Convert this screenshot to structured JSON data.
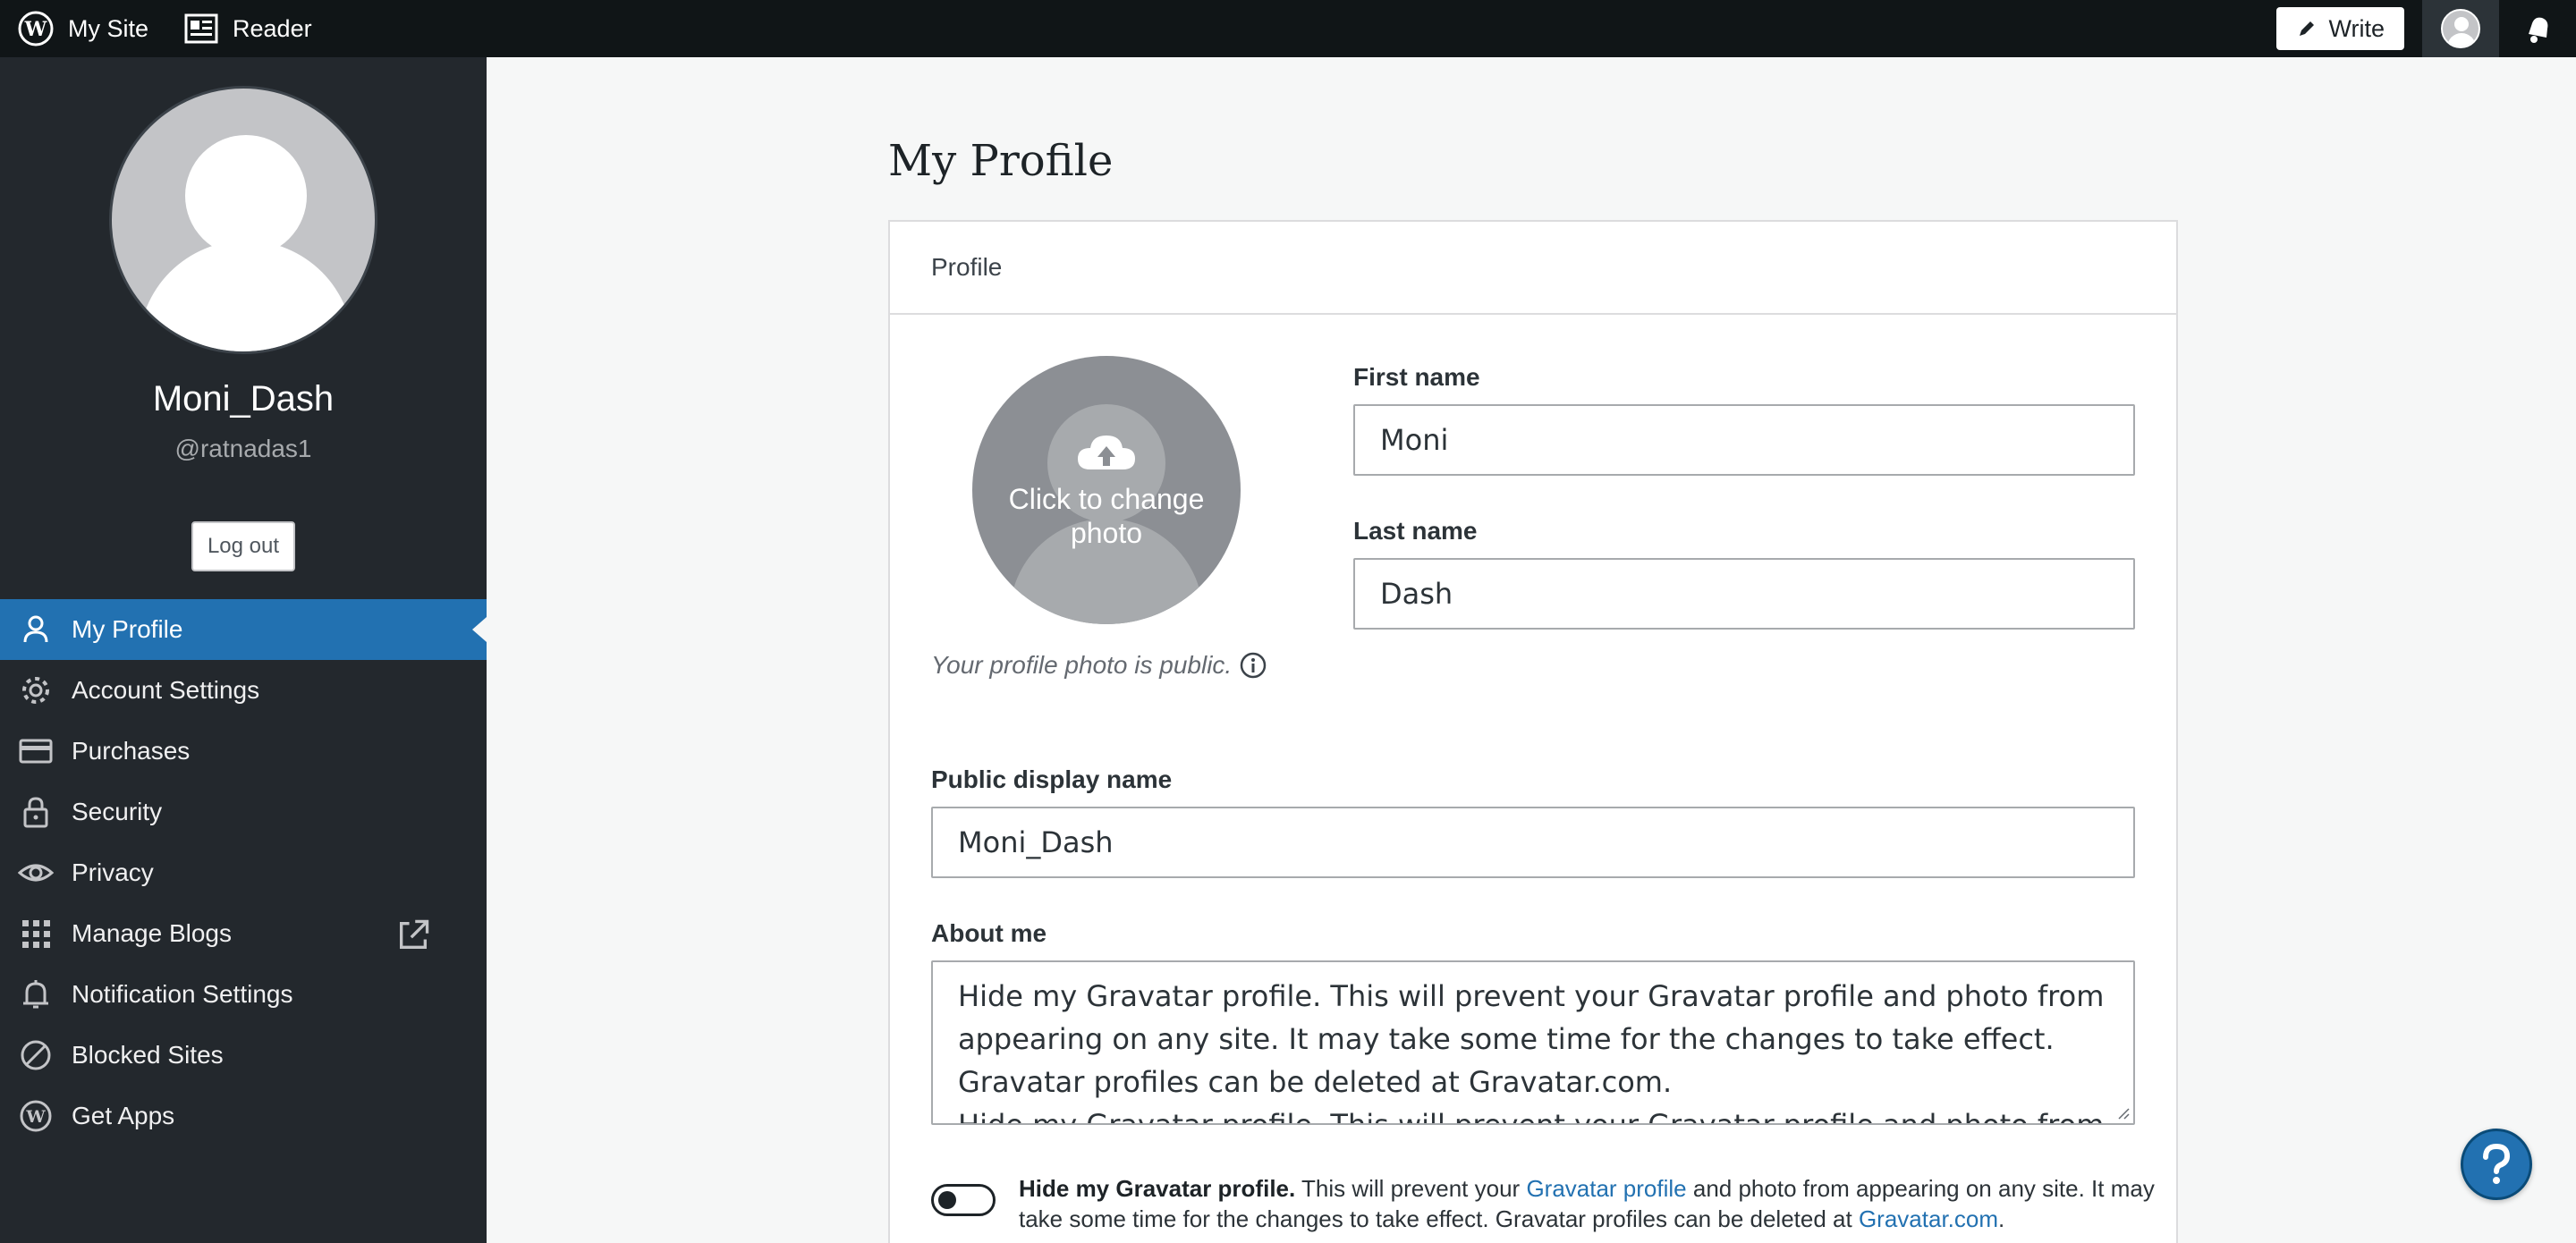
{
  "masterbar": {
    "my_site": "My Site",
    "reader": "Reader",
    "write": "Write"
  },
  "sidebar": {
    "display_name": "Moni_Dash",
    "handle": "@ratnadas1",
    "logout": "Log out",
    "items": [
      {
        "label": "My Profile",
        "icon": "person-icon",
        "active": true
      },
      {
        "label": "Account Settings",
        "icon": "gear-icon"
      },
      {
        "label": "Purchases",
        "icon": "credit-card-icon"
      },
      {
        "label": "Security",
        "icon": "lock-icon"
      },
      {
        "label": "Privacy",
        "icon": "eye-icon"
      },
      {
        "label": "Manage Blogs",
        "icon": "grid-icon",
        "external": true
      },
      {
        "label": "Notification Settings",
        "icon": "bell-icon"
      },
      {
        "label": "Blocked Sites",
        "icon": "blocked-icon"
      },
      {
        "label": "Get Apps",
        "icon": "wordpress-icon"
      }
    ]
  },
  "main": {
    "title": "My Profile",
    "card_header": "Profile",
    "photo_overlay": "Click to change photo",
    "photo_note": "Your profile photo is public.",
    "first_name_label": "First name",
    "first_name_value": "Moni",
    "last_name_label": "Last name",
    "last_name_value": "Dash",
    "display_name_label": "Public display name",
    "display_name_value": "Moni_Dash",
    "about_label": "About me",
    "about_value": "Hide my Gravatar profile. This will prevent your Gravatar profile and photo from appearing on any site. It may take some time for the changes to take effect. Gravatar profiles can be deleted at Gravatar.com.\nHide my Gravatar profile. This will prevent your Gravatar profile and photo from appearing on any site.",
    "toggle": {
      "on": false,
      "bold": "Hide my Gravatar profile.",
      "text1": "This will prevent your",
      "link1": "Gravatar profile",
      "text2": "and photo from appearing on any site. It may take some time for the changes to take effect. Gravatar profiles can be deleted at",
      "link2": "Gravatar.com",
      "text3": "."
    }
  },
  "colors": {
    "masterbar": "#101517",
    "sidebar": "#23282d",
    "accent": "#2271b1",
    "background": "#f6f7f7"
  }
}
